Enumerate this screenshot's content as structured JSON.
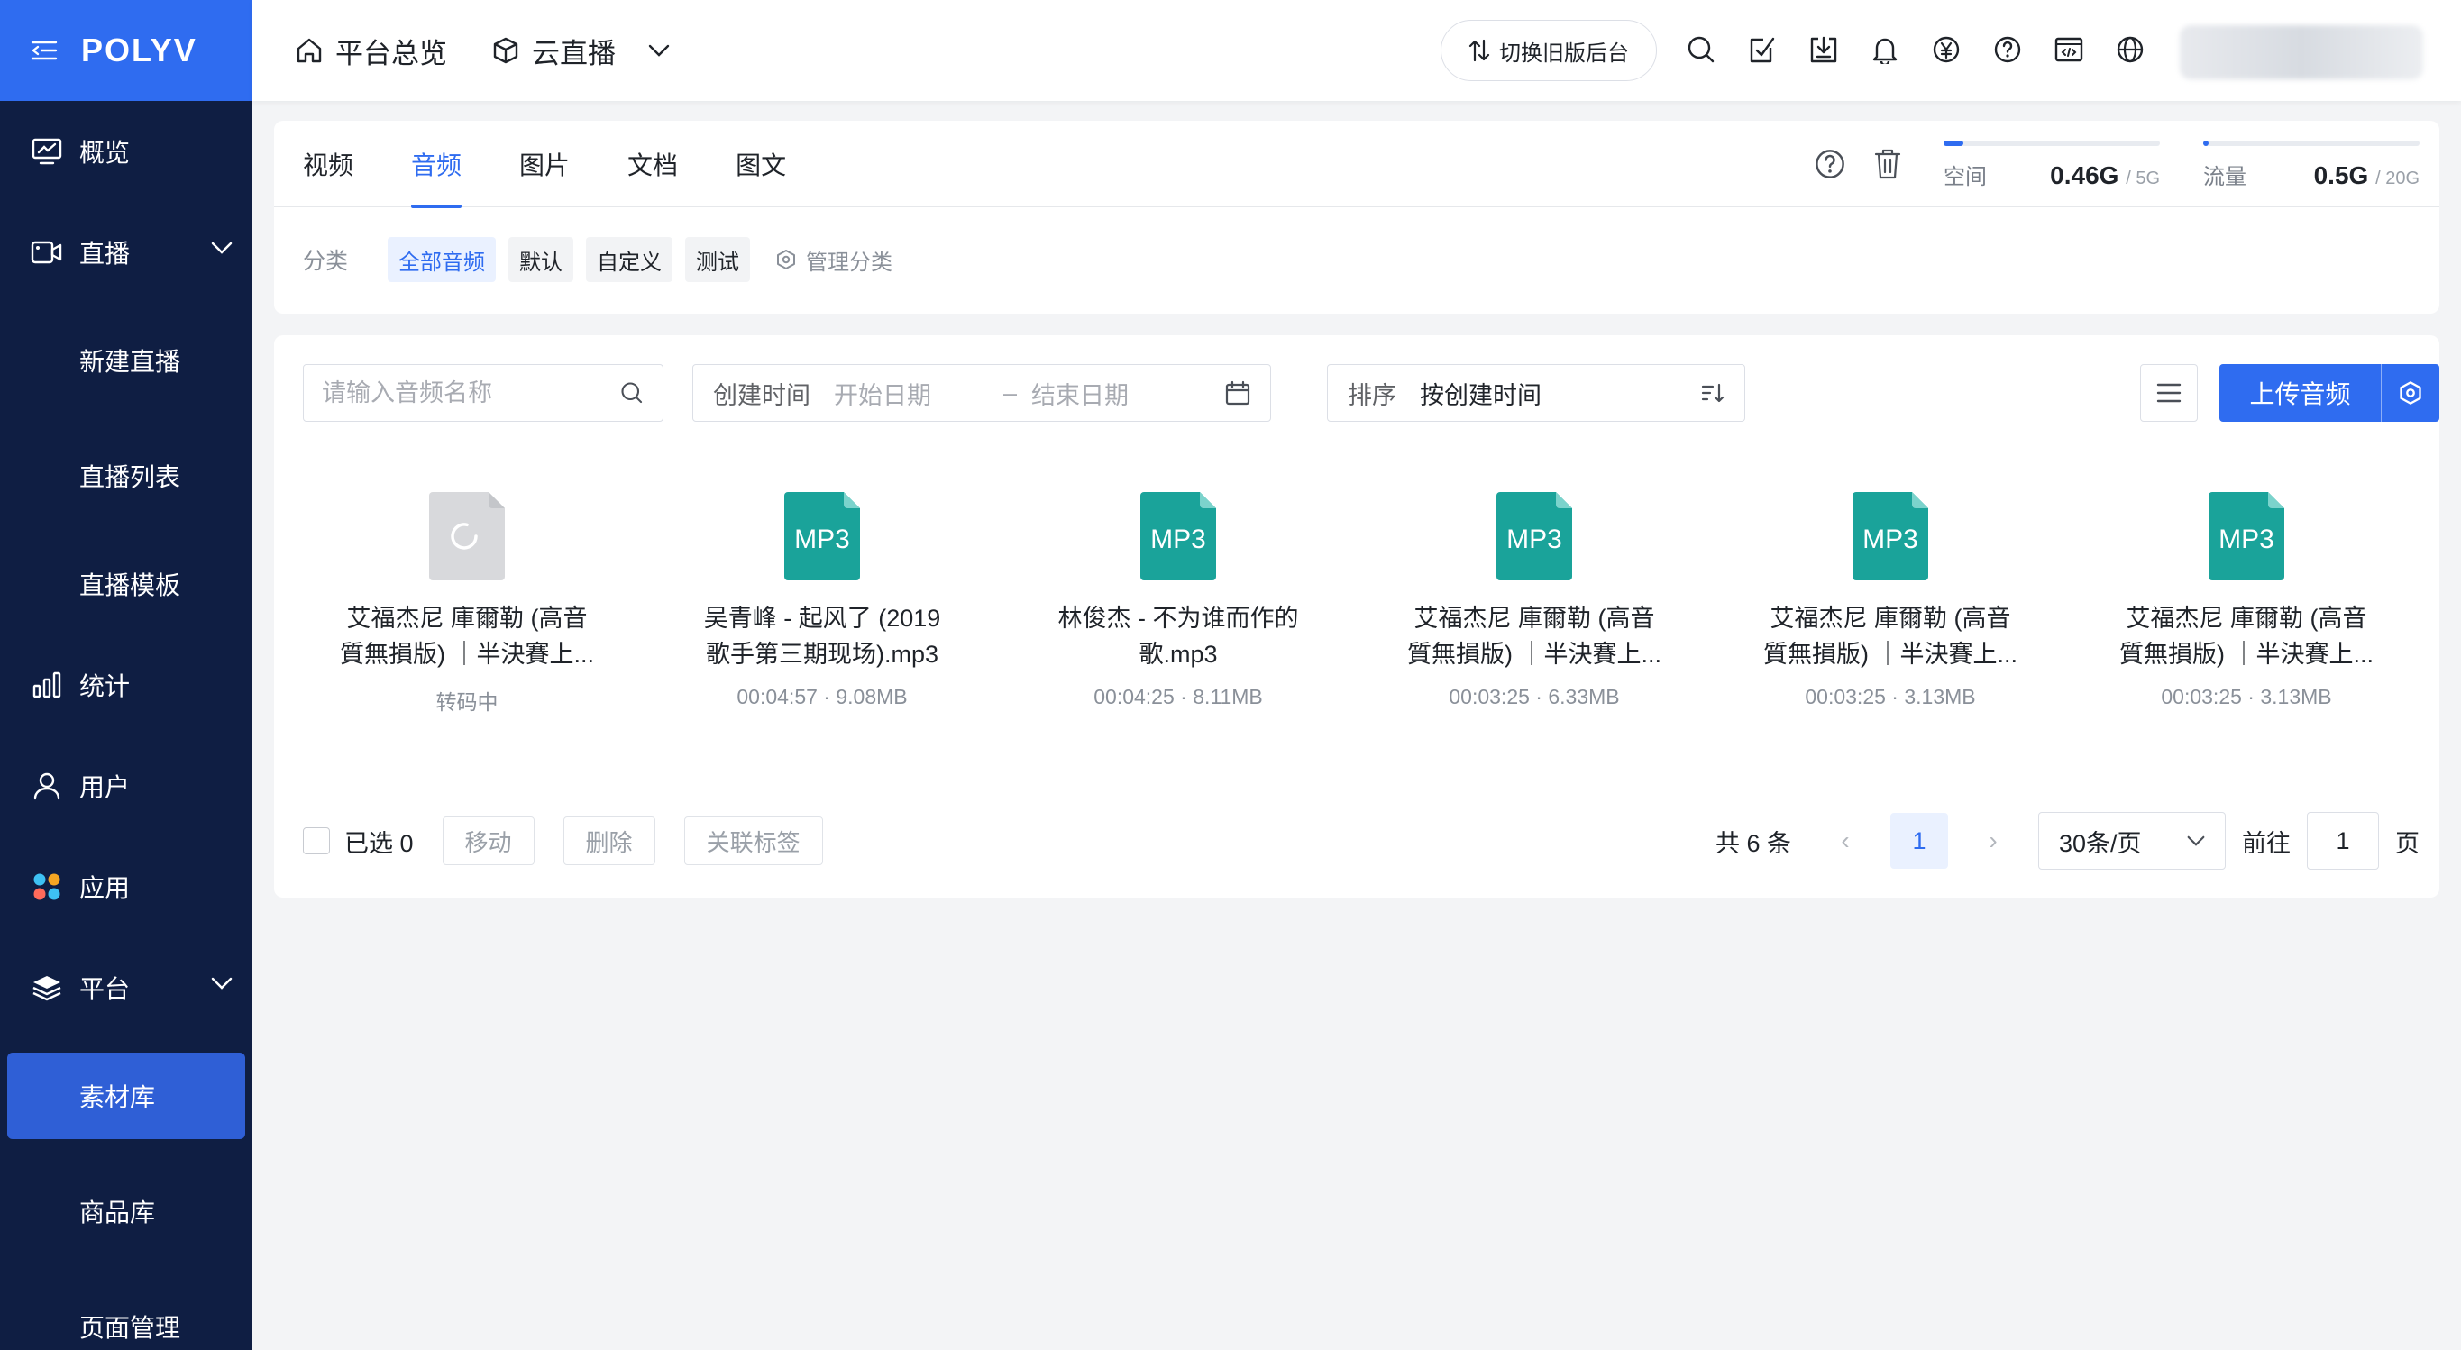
{
  "brand": {
    "name": "POLYV"
  },
  "sidebar": {
    "items": [
      {
        "label": "概览",
        "icon": "monitor-chart-icon"
      },
      {
        "label": "直播",
        "icon": "video-icon",
        "expandable": true
      },
      {
        "label": "新建直播",
        "sub": true
      },
      {
        "label": "直播列表",
        "sub": true
      },
      {
        "label": "直播模板",
        "sub": true
      },
      {
        "label": "统计",
        "icon": "bar-chart-icon"
      },
      {
        "label": "用户",
        "icon": "user-icon"
      },
      {
        "label": "应用",
        "icon": "apps-icon"
      },
      {
        "label": "平台",
        "icon": "layers-icon",
        "expandable": true
      },
      {
        "label": "素材库",
        "sub": true,
        "active": true
      },
      {
        "label": "商品库",
        "sub": true
      },
      {
        "label": "页面管理",
        "sub": true
      }
    ]
  },
  "topbar": {
    "home_label": "平台总览",
    "product_label": "云直播",
    "switch_label": "切换旧版后台"
  },
  "library": {
    "tabs": [
      "视频",
      "音频",
      "图片",
      "文档",
      "图文"
    ],
    "active_tab": "音频",
    "space": {
      "label": "空间",
      "value": "0.46G",
      "total": "/ 5G",
      "fraction": 0.092
    },
    "traffic": {
      "label": "流量",
      "value": "0.5G",
      "total": "/ 20G",
      "fraction": 0.025
    },
    "category_label": "分类",
    "categories": [
      "全部音频",
      "默认",
      "自定义",
      "测试"
    ],
    "active_category": "全部音频",
    "manage_label": "管理分类"
  },
  "filters": {
    "search_placeholder": "请输入音频名称",
    "created_label": "创建时间",
    "start_placeholder": "开始日期",
    "date_separator": "–",
    "end_placeholder": "结束日期",
    "sort_label": "排序",
    "sort_value": "按创建时间",
    "upload_label": "上传音频"
  },
  "files": [
    {
      "name_line1": "艾福杰尼 庫爾勒 (高音",
      "name_line2": "質無損版) ｜半決賽上...",
      "meta": "转码中",
      "status": "transcoding"
    },
    {
      "name_line1": "吴青峰 - 起风了 (2019",
      "name_line2": "歌手第三期现场).mp3",
      "meta": "00:04:57 · 9.08MB",
      "status": "mp3"
    },
    {
      "name_line1": "林俊杰 - 不为谁而作的",
      "name_line2": "歌.mp3",
      "meta": "00:04:25 · 8.11MB",
      "status": "mp3"
    },
    {
      "name_line1": "艾福杰尼 庫爾勒 (高音",
      "name_line2": "質無損版) ｜半決賽上...",
      "meta": "00:03:25 · 6.33MB",
      "status": "mp3"
    },
    {
      "name_line1": "艾福杰尼 庫爾勒 (高音",
      "name_line2": "質無損版) ｜半決賽上...",
      "meta": "00:03:25 · 3.13MB",
      "status": "mp3"
    },
    {
      "name_line1": "艾福杰尼 庫爾勒 (高音",
      "name_line2": "質無損版) ｜半決賽上...",
      "meta": "00:03:25 · 3.13MB",
      "status": "mp3"
    }
  ],
  "file_badge": "MP3",
  "footer": {
    "selected_label": "已选 0",
    "move_label": "移动",
    "delete_label": "删除",
    "tag_label": "关联标签",
    "total_label": "共 6 条",
    "prev": "‹",
    "current_page": "1",
    "next": "›",
    "page_size": "30条/页",
    "goto_label": "前往",
    "goto_value": "1",
    "page_unit": "页"
  },
  "colors": {
    "brand_blue": "#2f6cf0",
    "sidebar_bg": "#0f1e43",
    "mp3_teal": "#1aa39a"
  }
}
